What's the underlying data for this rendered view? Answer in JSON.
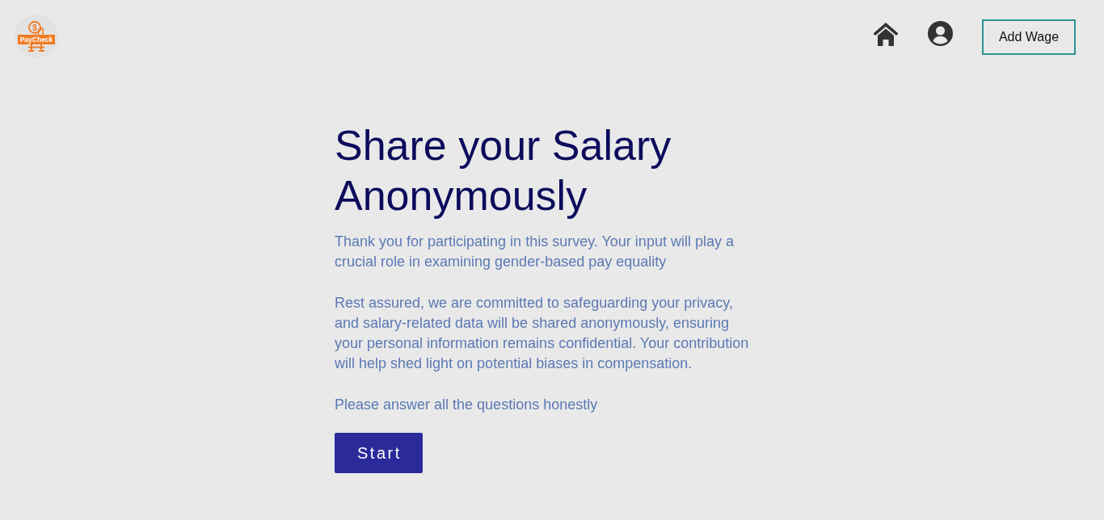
{
  "header": {
    "logo": {
      "symbol": "$",
      "text": "PayCheck"
    },
    "add_wage_button": "Add Wage"
  },
  "main": {
    "title": "Share your Salary Anonymously",
    "paragraphs": [
      "Thank you for participating in this survey. Your input will play a crucial role in examining gender-based pay equality",
      "Rest assured, we are committed to safeguarding your privacy, and salary-related data will be shared anonymously, ensuring your personal information remains confidential. Your contribution will help shed light on potential biases in compensation.",
      "Please answer all the questions honestly"
    ],
    "start_button": "Start"
  }
}
